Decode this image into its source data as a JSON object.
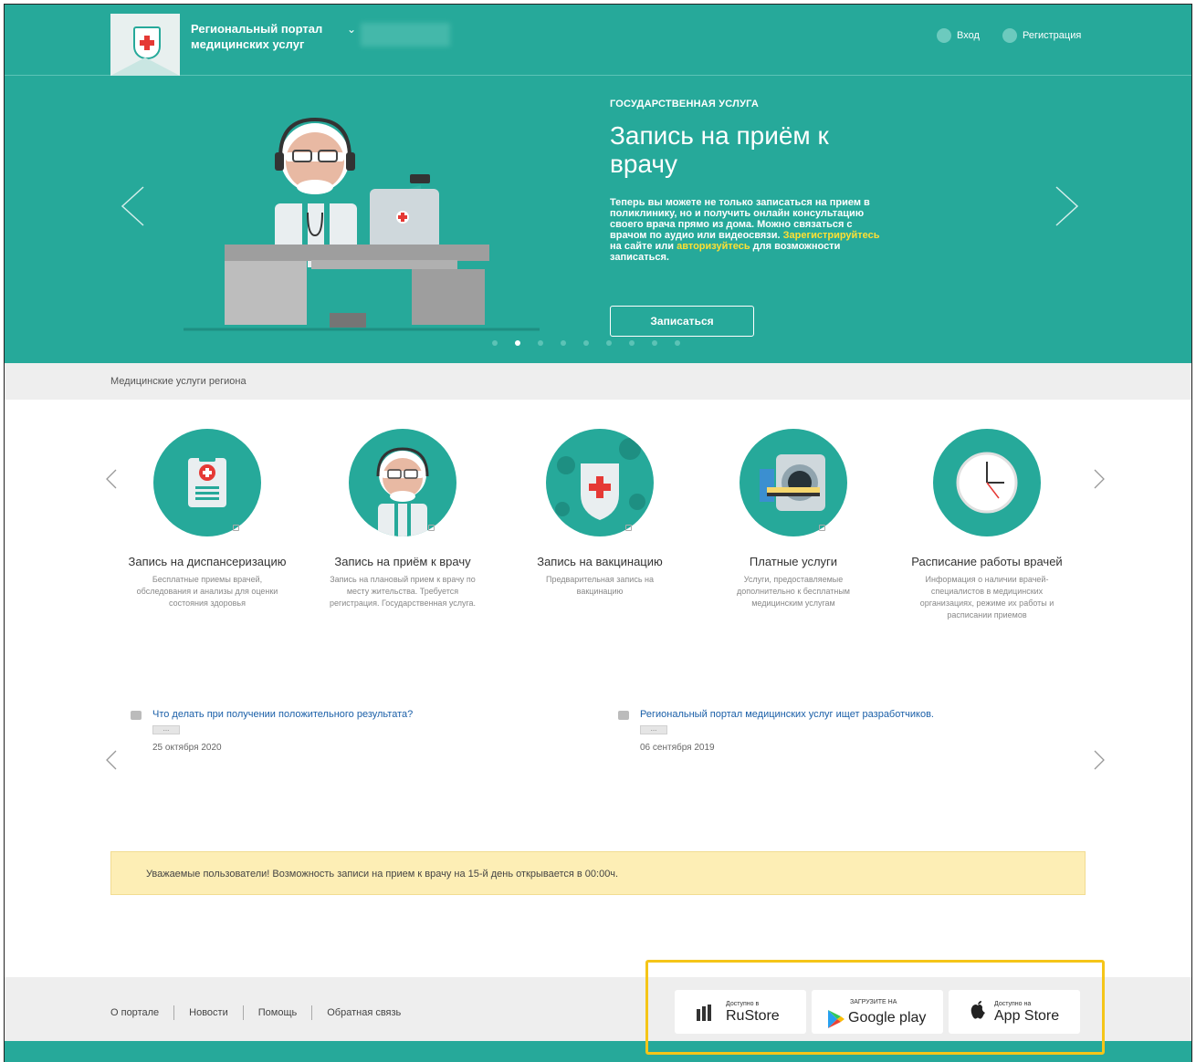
{
  "header": {
    "portal_title": "Региональный портал медицинских услуг",
    "region_chevron": "⌄",
    "login": "Вход",
    "register": "Регистрация"
  },
  "hero": {
    "kicker": "ГОСУДАРСТВЕННАЯ УСЛУГА",
    "title": "Запись на приём к врачу",
    "text_part1": "Теперь вы можете не только записаться на прием в поликлинику, но и получить онлайн консультацию своего врача прямо из дома. Можно связаться с врачом по аудио или видеосвязи. ",
    "text_link1": "Зарегистрируйтесь",
    "text_part2": " на сайте или ",
    "text_link2": "авторизуйтесь",
    "text_part3": " для возможности записаться.",
    "button": "Записаться",
    "slide_count": 9,
    "active_slide": 2
  },
  "services_section": {
    "title": "Медицинские услуги региона",
    "items": [
      {
        "name": "Запись на диспансеризацию",
        "desc": "Бесплатные приемы врачей, обследования и анализы для оценки состояния здоровья",
        "icon": "clipboard-icon"
      },
      {
        "name": "Запись на приём к врачу",
        "desc": "Запись на плановый прием к врачу по месту жительства. Требуется регистрация. Государственная услуга.",
        "icon": "doctor-icon"
      },
      {
        "name": "Запись на вакцинацию",
        "desc": "Предварительная запись на вакцинацию",
        "icon": "vaccine-shield-icon"
      },
      {
        "name": "Платные услуги",
        "desc": "Услуги, предоставляемые дополнительно к бесплатным медицинским услугам",
        "icon": "mri-scanner-icon"
      },
      {
        "name": "Расписание работы врачей",
        "desc": "Информация о наличии врачей-специалистов в медицинских организациях, режиме их работы и расписании приемов",
        "icon": "clock-icon"
      }
    ]
  },
  "news": [
    {
      "title": "Что делать при получении положительного результата?",
      "more": "...",
      "date": "25 октября 2020"
    },
    {
      "title": "Региональный портал медицинских услуг ищет разработчиков.",
      "more": "...",
      "date": "06 сентября 2019"
    }
  ],
  "notice": "Уважаемые пользователи! Возможность записи на прием к врачу на 15-й день открывается в 00:00ч.",
  "footer": {
    "links": [
      "О портале",
      "Новости",
      "Помощь",
      "Обратная связь"
    ],
    "stores": [
      {
        "small": "Доступно в",
        "big": "RuStore",
        "icon": "rustore-icon"
      },
      {
        "small": "ЗАГРУЗИТЕ НА",
        "big": "Google play",
        "icon": "google-play-icon"
      },
      {
        "small": "Доступно на",
        "big": "App Store",
        "icon": "apple-icon"
      }
    ]
  },
  "colors": {
    "brand": "#26a99a",
    "accent_link": "#ffe033",
    "notice_bg": "#fdeeb5",
    "highlight": "#f5c518"
  }
}
